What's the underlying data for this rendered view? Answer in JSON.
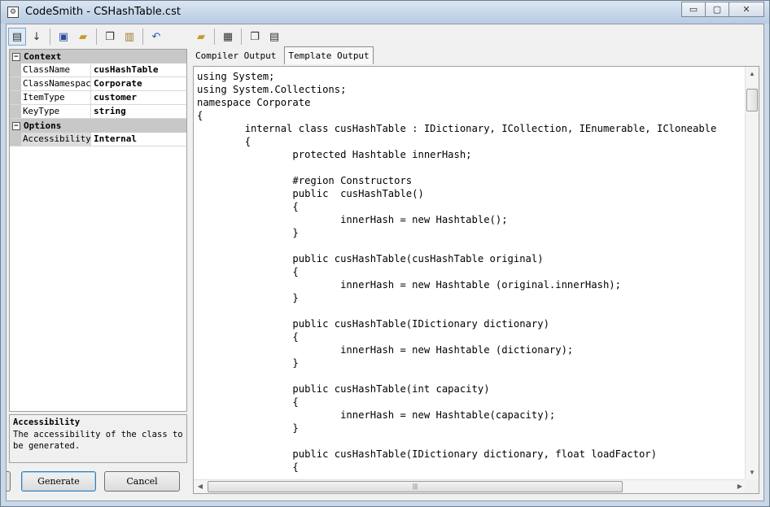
{
  "window": {
    "title": "CodeSmith - CSHashTable.cst",
    "minimize_glyph": "▭",
    "maximize_glyph": "▢",
    "close_glyph": "✕"
  },
  "toolbar": {
    "left_icons": [
      "categorized-icon",
      "alphabetical-icon",
      "save-icon",
      "open-icon",
      "copy-icon",
      "paste-icon",
      "undo-icon"
    ],
    "right_icons": [
      "open-folder-icon",
      "calendar-icon",
      "copy-output-icon",
      "save-output-icon"
    ]
  },
  "propgrid": {
    "categories": [
      {
        "name": "Context",
        "toggle": "−",
        "rows": [
          {
            "name": "ClassName",
            "value": "cusHashTable"
          },
          {
            "name": "ClassNamespace",
            "value": "Corporate"
          },
          {
            "name": "ItemType",
            "value": "customer"
          },
          {
            "name": "KeyType",
            "value": "string"
          }
        ]
      },
      {
        "name": "Options",
        "toggle": "−",
        "rows": [
          {
            "name": "Accessibility",
            "value": "Internal"
          }
        ]
      }
    ],
    "description": {
      "title": "Accessibility",
      "text": "The accessibility of the class to be generated."
    }
  },
  "buttons": {
    "generate": "Generate",
    "cancel": "Cancel"
  },
  "tabs": [
    {
      "label": "Compiler Output",
      "active": false
    },
    {
      "label": "Template Output",
      "active": true
    }
  ],
  "code_lines": [
    "using System;",
    "using System.Collections;",
    "namespace Corporate",
    "{",
    "        internal class cusHashTable : IDictionary, ICollection, IEnumerable, ICloneable",
    "        {",
    "                protected Hashtable innerHash;",
    "",
    "                #region Constructors",
    "                public  cusHashTable()",
    "                {",
    "                        innerHash = new Hashtable();",
    "                }",
    "",
    "                public cusHashTable(cusHashTable original)",
    "                {",
    "                        innerHash = new Hashtable (original.innerHash);",
    "                }",
    "",
    "                public cusHashTable(IDictionary dictionary)",
    "                {",
    "                        innerHash = new Hashtable (dictionary);",
    "                }",
    "",
    "                public cusHashTable(int capacity)",
    "                {",
    "                        innerHash = new Hashtable(capacity);",
    "                }",
    "",
    "                public cusHashTable(IDictionary dictionary, float loadFactor)",
    "                {"
  ],
  "scroll_glyphs": {
    "up": "▲",
    "down": "▼",
    "left": "◀",
    "right": "▶",
    "grip": "|||"
  }
}
